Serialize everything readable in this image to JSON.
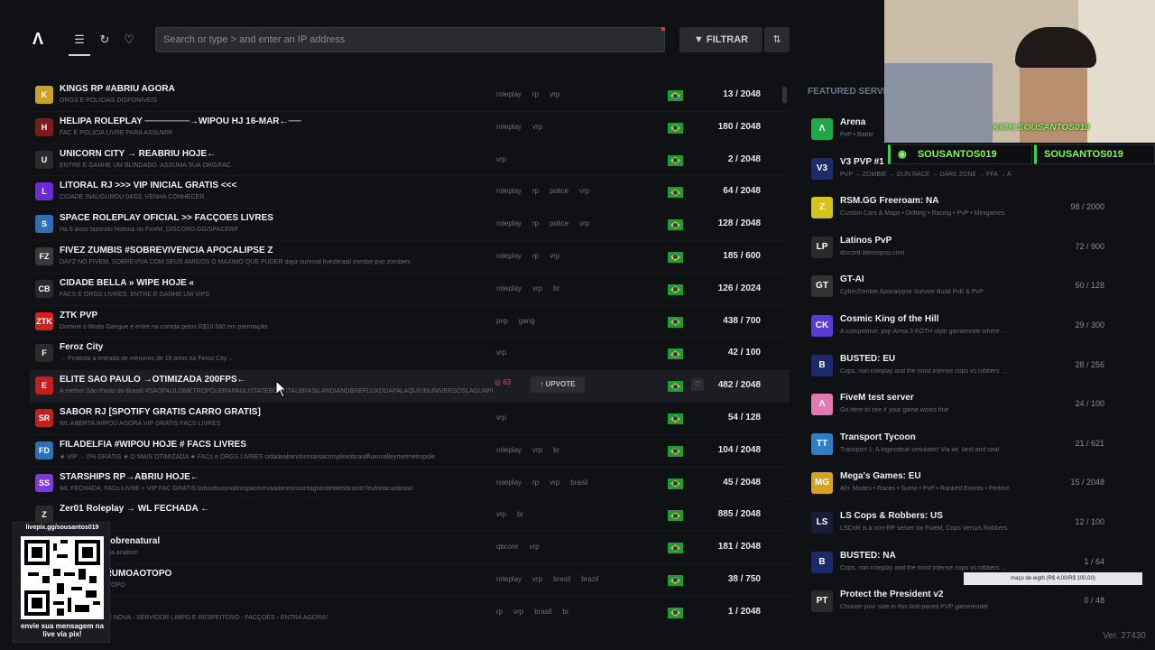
{
  "search": {
    "placeholder": "Search or type > and enter an IP address"
  },
  "toolbar": {
    "filter_label": "FILTRAR",
    "sort_icon": "sort-icon"
  },
  "featured_title": "FEATURED SERVE",
  "servers": [
    {
      "name": "KINGS RP #ABRIU AGORA",
      "desc": "ORGS E POLICIAS DISPONIVEIS",
      "tags": [
        "roleplay",
        "rp",
        "vrp"
      ],
      "players": "13 / 2048",
      "icon_color": "#c9a227",
      "icon": "K"
    },
    {
      "name": "HELIPA ROLEPLAY ───────→WIPOU HJ 16-MAR←──",
      "desc": "FAC E POLICIA LIVRE PARA ASSUMIR",
      "tags": [
        "roleplay",
        "vrp"
      ],
      "players": "180 / 2048",
      "icon_color": "#7a1c1c",
      "icon": "H"
    },
    {
      "name": "UNICORN CITY → REABRIU HOJE←",
      "desc": "ENTRE E GANHE UM BLINDADO. ASSUMA SUA ORG/FAC.",
      "tags": [
        "vrp"
      ],
      "players": "2 / 2048",
      "icon_color": "#2b2b2b",
      "icon": "U"
    },
    {
      "name": "LITORAL RJ >>> VIP INICIAL GRATIS <<<",
      "desc": "CIDADE INAUGUROU 04/03, VENHA CONHECER.",
      "tags": [
        "roleplay",
        "rp",
        "police",
        "vrp"
      ],
      "players": "64 / 2048",
      "icon_color": "#6a2bd6",
      "icon": "L"
    },
    {
      "name": "SPACE ROLEPLAY OFICIAL >> FACÇOES LIVRES",
      "desc": "Há 5 anos fazendo história no FiveM, DISCORD.GG/SPACERP",
      "tags": [
        "roleplay",
        "rp",
        "police",
        "vrp"
      ],
      "players": "128 / 2048",
      "icon_color": "#2f6fb5",
      "icon": "S"
    },
    {
      "name": "FIVEZ ZUMBIS #SOBREVIVENCIA APOCALIPSE Z",
      "desc": "DAYZ NO FIVEM, SOBREVIVA COM SEUS AMIGOS O MAXIMO QUE PUDER dayz survival fivezbrasil zombie pvp zombies",
      "tags": [
        "roleplay",
        "rp",
        "vrp"
      ],
      "players": "185 / 600",
      "icon_color": "#3a3a3a",
      "icon": "FZ"
    },
    {
      "name": "CIDADE BELLA » WIPE HOJE «",
      "desc": "FACS E ORGS LIVRES, ENTRE E GANHE UM VIPS",
      "tags": [
        "roleplay",
        "vrp",
        "br"
      ],
      "players": "126 / 2024",
      "icon_color": "#2a2a2a",
      "icon": "CB"
    },
    {
      "name": "ZTK PVP",
      "desc": "Domine o Modo Gangue e entre na corrida pelos R$10.680 em premiação.",
      "tags": [
        "pvp",
        "gang"
      ],
      "players": "438 / 700",
      "icon_color": "#d61f1f",
      "icon": "ZTK"
    },
    {
      "name": "Feroz City",
      "desc": "→ Proibida a entrada de menores de 18 anos na Feroz City ←",
      "tags": [
        "vrp"
      ],
      "players": "42 / 100",
      "icon_color": "#2a2a2a",
      "icon": "F"
    },
    {
      "name": "ELITE SAO PAULO →OTIMIZADA 200FPS←",
      "desc": "A melhor São Paulo do Brasil! #SAOPAULOMETROPOLERAPAULISTATEBCAPITALBRASILANDIANDBREFLUXODAPALAQUIUNUNIVERSOSLAGUAPESTA",
      "tags": [],
      "players": "482 / 2048",
      "icon_color": "#c21f1f",
      "icon": "E",
      "upvotes": "63",
      "upvote_label": "UPVOTE",
      "highlighted": true
    },
    {
      "name": "SABOR RJ  [SPOTIFY GRATIS CARRO GRATIS]",
      "desc": "WL ABERTA WIPOU AGORA VIP GRATIS FACS LIVRES",
      "tags": [
        "vrp"
      ],
      "players": "54 / 128",
      "icon_color": "#c21f1f",
      "icon": "SR"
    },
    {
      "name": "FILADELFIA #WIPOU HOJE # FACS LIVRES",
      "desc": "★ VIP → 0% GRÁTIS ★ O MAIS OTIMIZADA ★ FACs e ORGS LIVRES cidadealtanobresantacomplexobrasilfluxovalleymetmetropole",
      "tags": [
        "roleplay",
        "vrp",
        "br"
      ],
      "players": "104 / 2048",
      "icon_color": "#2f6fb5",
      "icon": "FD"
    },
    {
      "name": "STARSHIPS RP→ABRIU HOJE←",
      "desc": "WL FECHADA, FACs LIVRE + VIP FAC GRATIS lisboafluxonobrespacerevoadaneonsantagrandelotesbrasilz7eufortacaobrasil",
      "tags": [
        "roleplay",
        "rp",
        "vrp",
        "brasil"
      ],
      "players": "45 / 2048",
      "icon_color": "#7a3bd6",
      "icon": "SS"
    },
    {
      "name": "Zer01 Roleplay → WL FECHADA ←",
      "desc": "",
      "tags": [
        "vrp",
        "br"
      ],
      "players": "885 / 2048",
      "icon_color": "#2a2a2a",
      "icon": "Z"
    },
    {
      "name": "…nPlay & Sobrenatural",
      "desc": "… e RP para nossa análise!",
      "tags": [
        "qbcore",
        "vrp"
      ],
      "players": "181 / 2048",
      "icon_color": "#3a3a3a",
      "icon": "N"
    },
    {
      "name": "…EPLAY #RUMOAOTOPO",
      "desc": "…AY #RUMOAOTOPO",
      "tags": [
        "roleplay",
        "vrp",
        "brasil",
        "brazil"
      ],
      "players": "38 / 750",
      "icon_color": "#3a3a3a",
      "icon": "R"
    },
    {
      "name": "…P",
      "desc": "…HOJE | CIDADE NOVA - SERVIDOR LIMPO E RESPEITOSO - FACÇÕES - ENTRA AGORA!",
      "tags": [
        "rp",
        "vrp",
        "brasil",
        "br"
      ],
      "players": "1 / 2048",
      "icon_color": "#3a3a3a",
      "icon": "P"
    }
  ],
  "featured": [
    {
      "name": "Arena",
      "desc": "PvP • Battle",
      "players": "",
      "icon_color": "#1fa84a",
      "icon": "Λ"
    },
    {
      "name": "V3 PVP #1",
      "desc": "PVP → ZOMBIE → GUN RACE → DARK ZONE → FFA → AIRDROP",
      "players": "",
      "icon_color": "#1c2b6a",
      "icon": "V3"
    },
    {
      "name": "RSM.GG Freeroam: NA",
      "desc": "Custom Cars & Maps • Drifting • Racing • PvP • Minigames",
      "players": "98 / 2000",
      "icon_color": "#d4c21f",
      "icon": "Z"
    },
    {
      "name": "Latinos PvP",
      "desc": "discord.latinospvp.com",
      "players": "72 / 900",
      "icon_color": "#2a2a2a",
      "icon": "LP"
    },
    {
      "name": "GT-AI",
      "desc": "CyberZombie Apocalypse Survive Build PvE & PvP",
      "players": "50 / 128",
      "icon_color": "#333",
      "icon": "GT"
    },
    {
      "name": "Cosmic King of the Hill",
      "desc": "A competitive, pvp Arma 3 KOTH style gamemode where …",
      "players": "29 / 300",
      "icon_color": "#5a3bd6",
      "icon": "CK"
    },
    {
      "name": "BUSTED: EU",
      "desc": "Cops, non roleplay and the most intense cops vs robbers …",
      "players": "28 / 256",
      "icon_color": "#1a2a6a",
      "icon": "B"
    },
    {
      "name": "FiveM test server",
      "desc": "Go here to see if your game works fine",
      "players": "24 / 100",
      "icon_color": "#e07ab0",
      "icon": "Λ"
    },
    {
      "name": "Transport Tycoon",
      "desc": "Transport 1: A logicistical simulator! Via air, land and seal",
      "players": "21 / 621",
      "icon_color": "#2f7fc5",
      "icon": "TT"
    },
    {
      "name": "Mega's Games: EU",
      "desc": "40+ Modes • Races • Sumo • PvP • Ranked Events • Perfect…",
      "players": "15 / 2048",
      "icon_color": "#d6a21f",
      "icon": "MG"
    },
    {
      "name": "LS Cops & Robbers: US",
      "desc": "LSCnR is a non-RP server for FiveM, Cops Versus Robbers …",
      "players": "12 / 100",
      "icon_color": "#1a1a3a",
      "icon": "LS"
    },
    {
      "name": "BUSTED: NA",
      "desc": "Cops, non roleplay and the most intense cops vs robbers …",
      "players": "1 / 64",
      "icon_color": "#1a2a6a",
      "icon": "B"
    },
    {
      "name": "Protect the President v2",
      "desc": "Choose your side in this fast-paced PVP gamemodel",
      "players": "0 / 48",
      "icon_color": "#2a2a2a",
      "icon": "PT"
    }
  ],
  "stream": {
    "kick_label": "KICK:SOUSANTOS019",
    "handle_1": "SOUSANTOS019",
    "handle_2": "SOUSANTOS019",
    "qr_url": "livepix.gg/sousantos019",
    "qr_text": "envie sua mensagem na live via pix!",
    "tooltip": "maço de eigth (R$ 4,00/R$ 100,00)"
  },
  "version": "Ver. 27430"
}
